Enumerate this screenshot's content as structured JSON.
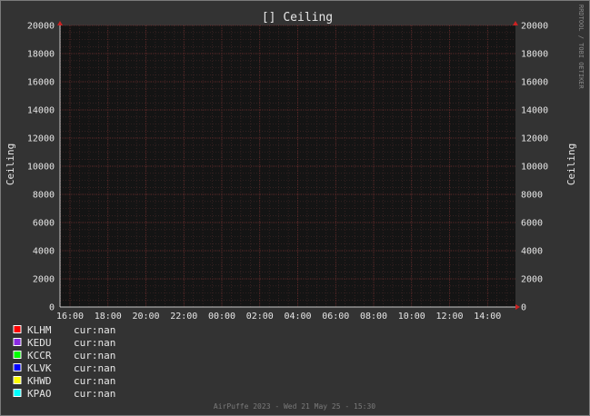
{
  "chart_data": {
    "type": "line",
    "title": "[] Ceiling",
    "ylabel_left": "Ceiling",
    "ylabel_right": "Ceiling",
    "ylim": [
      0,
      20000
    ],
    "y_ticks": [
      "0",
      "2000",
      "4000",
      "6000",
      "8000",
      "10000",
      "12000",
      "14000",
      "16000",
      "18000",
      "20000"
    ],
    "x_ticks": [
      "16:00",
      "18:00",
      "20:00",
      "22:00",
      "00:00",
      "02:00",
      "04:00",
      "06:00",
      "08:00",
      "10:00",
      "12:00",
      "14:00"
    ],
    "grid": true,
    "series": [
      {
        "name": "KLHM",
        "color": "#ff0000",
        "current": "cur:nan",
        "values": []
      },
      {
        "name": "KEDU",
        "color": "#8a2be2",
        "current": "cur:nan",
        "values": []
      },
      {
        "name": "KCCR",
        "color": "#00ff00",
        "current": "cur:nan",
        "values": []
      },
      {
        "name": "KLVK",
        "color": "#0000ff",
        "current": "cur:nan",
        "values": []
      },
      {
        "name": "KHWD",
        "color": "#ffff00",
        "current": "cur:nan",
        "values": []
      },
      {
        "name": "KPAO",
        "color": "#00ffff",
        "current": "cur:nan",
        "values": []
      }
    ]
  },
  "watermark": "RRDTOOL / TOBI OETIKER",
  "footer": "AirPuffe 2023 - Wed 21 May 25 - 15:30"
}
